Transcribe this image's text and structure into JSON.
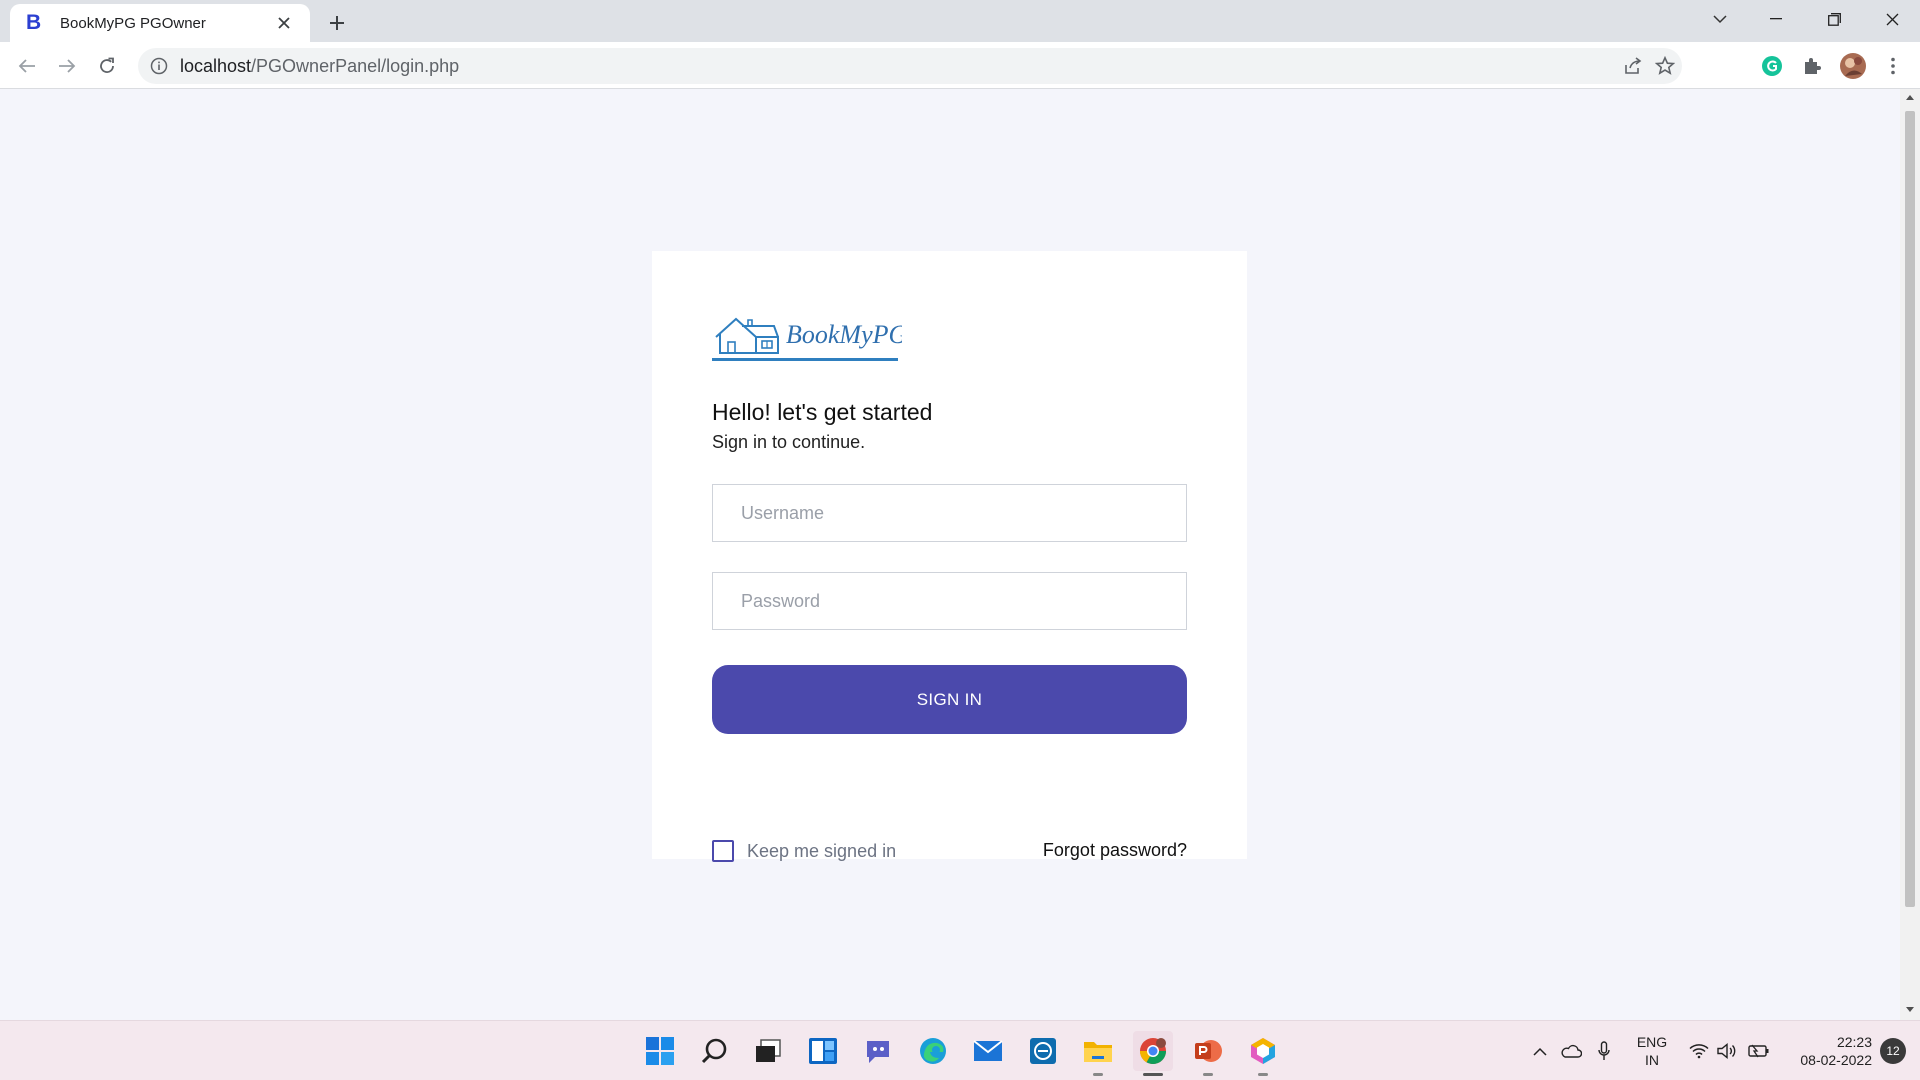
{
  "browser": {
    "tab_title": "BookMyPG PGOwner",
    "favicon_letter": "B",
    "url_host": "localhost",
    "url_path": "/PGOwnerPanel/login.php"
  },
  "login": {
    "brand_text": "BookMyPG",
    "greeting": "Hello! let's get started",
    "subtitle": "Sign in to continue.",
    "username_placeholder": "Username",
    "password_placeholder": "Password",
    "signin_label": "SIGN IN",
    "keep_signed_in_label": "Keep me signed in",
    "keep_signed_in_checked": false,
    "forgot_password_label": "Forgot password?"
  },
  "taskbar": {
    "apps": [
      "start-icon",
      "search-icon",
      "task-view-icon",
      "widgets-icon",
      "teams-chat-icon",
      "edge-icon",
      "mail-icon",
      "dell-icon",
      "file-explorer-icon",
      "chrome-icon",
      "powerpoint-icon",
      "app-icon"
    ],
    "language_line1": "ENG",
    "language_line2": "IN",
    "time": "22:23",
    "date": "08-02-2022",
    "notification_count": "12"
  },
  "colors": {
    "accent": "#4b49ac",
    "page_background": "#f4f5fb",
    "card_background": "#ffffff",
    "logo_blue": "#2f7fbf"
  }
}
